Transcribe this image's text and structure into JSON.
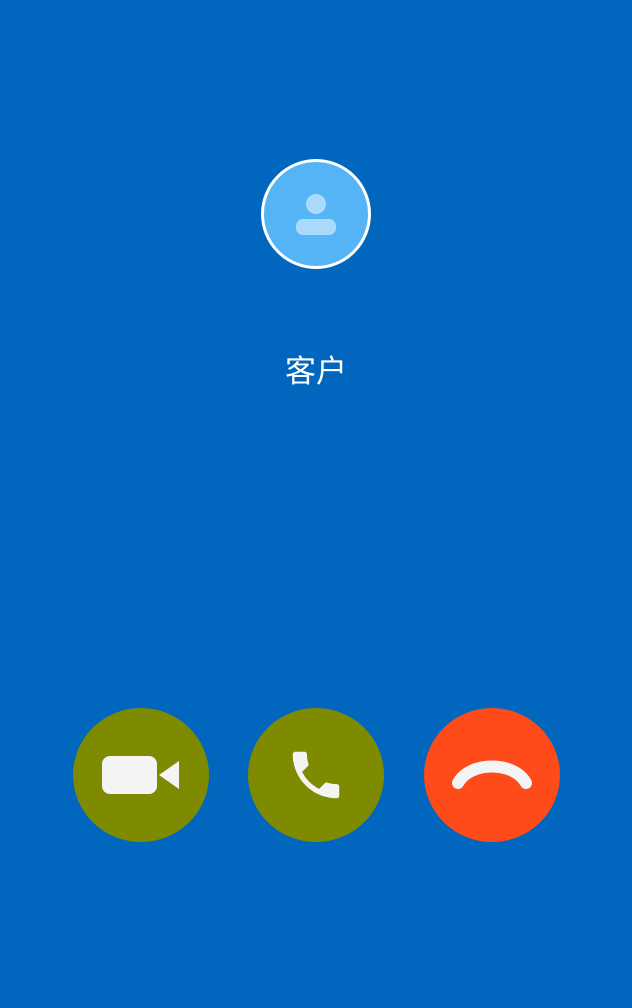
{
  "caller": {
    "name": "客户",
    "avatar_icon": "person-icon"
  },
  "actions": [
    {
      "id": "video",
      "icon": "video-camera-icon",
      "color": "#7E8A00"
    },
    {
      "id": "answer",
      "icon": "phone-icon",
      "color": "#7E8A00"
    },
    {
      "id": "decline",
      "icon": "phone-hangup-icon",
      "color": "#FF4A1A"
    }
  ],
  "colors": {
    "background": "#0066BE",
    "avatar": "#55B4F6"
  }
}
